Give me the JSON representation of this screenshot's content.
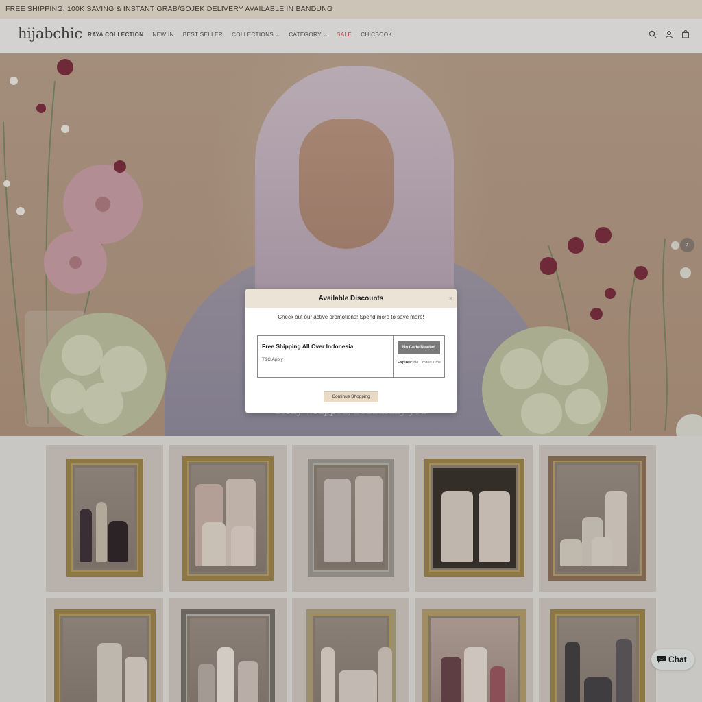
{
  "announcement": "FREE SHIPPING, 100K SAVING & INSTANT GRAB/GOJEK DELIVERY AVAILABLE IN BANDUNG",
  "header": {
    "logo": "hijabchic",
    "nav": [
      {
        "label": "RAYA COLLECTION",
        "bold": true
      },
      {
        "label": "NEW IN"
      },
      {
        "label": "BEST SELLER"
      },
      {
        "label": "COLLECTIONS",
        "dropdown": true
      },
      {
        "label": "CATEGORY",
        "dropdown": true
      },
      {
        "label": "SALE",
        "sale": true
      },
      {
        "label": "CHICBOOK"
      }
    ],
    "icons": [
      "search-icon",
      "account-icon",
      "cart-icon"
    ]
  },
  "hero": {
    "caption": "softly wrapped, beautifully you",
    "next_arrow": "›"
  },
  "modal": {
    "title": "Available Discounts",
    "close": "×",
    "subtitle": "Check out our active promotions! Spend more to save more!",
    "promo": {
      "name": "Free Shipping All Over Indonesia",
      "terms": "T&C Apply",
      "code_badge": "No Code Needed",
      "expires_label": "Expires:",
      "expires_value": "No Limited Time"
    },
    "continue_label": "Continue Shopping"
  },
  "chat": {
    "label": "Chat"
  },
  "colors": {
    "announcement_bg": "#ccc4b6",
    "modal_header_bg": "#ebe3d6",
    "sale_red": "#b8484a",
    "button_bg": "#eadbc6"
  }
}
